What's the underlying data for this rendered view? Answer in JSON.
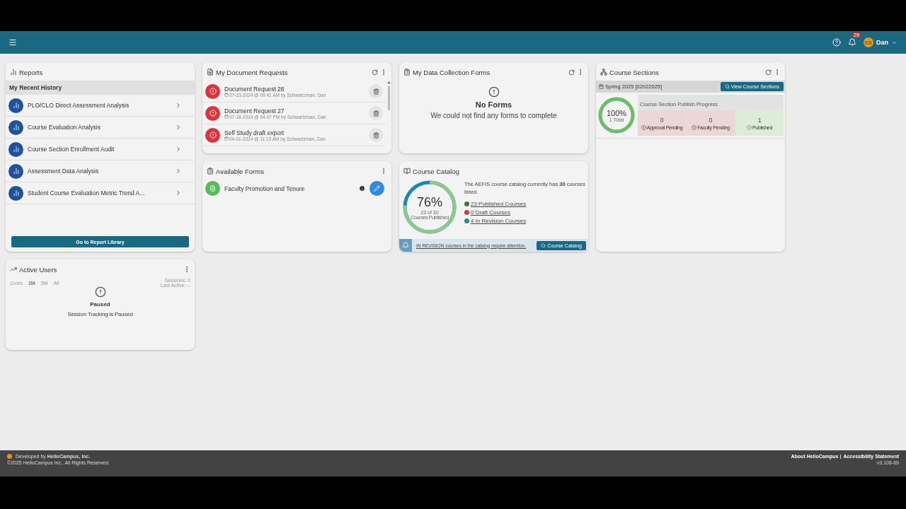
{
  "header": {
    "notification_count": "29",
    "avatar_initials": "DS",
    "user_name": "Dan"
  },
  "reports": {
    "title": "Reports",
    "section": "My Recent History",
    "items": [
      {
        "label": "PLO/CLO Direct Assessment Analysis"
      },
      {
        "label": "Course Evaluation Analysis"
      },
      {
        "label": "Course Section Enrollment Audit"
      },
      {
        "label": "Assessment Data Analysis"
      },
      {
        "label": "Student Course Evaluation Metric Trend A..."
      }
    ],
    "button": "Go to Report Library"
  },
  "document_requests": {
    "title": "My Document Requests",
    "items": [
      {
        "name": "Document Request 28",
        "meta": "07-23-2024 @ 09:41 AM by Schwartzman, Dan"
      },
      {
        "name": "Document Request 27",
        "meta": "07-18-2024 @ 04:07 PM by Schwartzman, Dan"
      },
      {
        "name": "Self Study draft export",
        "meta": "04-01-2024 @ 11:19 AM by Schwartzman, Dan"
      }
    ]
  },
  "data_collection": {
    "title": "My Data Collection Forms",
    "empty_title": "No Forms",
    "empty_text": "We could not find any forms to complete"
  },
  "course_sections": {
    "title": "Course Sections",
    "term": "Spring 2025 [02022025]",
    "button": "View Course Sections",
    "percent": "100%",
    "level": 1,
    "total": "1 Total",
    "progress_title": "Course Section Publish Progress",
    "stages": [
      {
        "count": "0",
        "label": "Approval Pending",
        "kind": "pending"
      },
      {
        "count": "0",
        "label": "Faculty Pending",
        "kind": "pending"
      },
      {
        "count": "1",
        "label": "Published",
        "kind": "done"
      }
    ]
  },
  "available_forms": {
    "title": "Available Forms",
    "items": [
      {
        "label": "Faculty Promotion and Tenure"
      }
    ]
  },
  "course_catalog": {
    "title": "Course Catalog",
    "percent": "76%",
    "level": 0.76,
    "sub": "23 of 30",
    "sub2": "Courses Published",
    "summary": "The AEFIS course catalog currently has **30** courses listed.",
    "links": [
      {
        "label": "23 Published Courses",
        "color": "#3f7a3c"
      },
      {
        "label": "0 Draft Courses",
        "color": "#c43d4e"
      },
      {
        "label": "4 In Revision Courses",
        "color": "#23908f"
      }
    ],
    "alert": "IN REVISION courses in the catalog require attention.",
    "button": "Course Catalog"
  },
  "active_users": {
    "title": "Active Users",
    "zoom_label": "Zoom",
    "zoom_options": [
      {
        "label": "1M",
        "selected": true
      },
      {
        "label": "5M",
        "selected": false
      },
      {
        "label": "All",
        "selected": false
      }
    ],
    "sessions": "Sessions: 0",
    "last_active": "Last Active: --",
    "status_title": "Paused",
    "status_text": "Session Tracking is Paused"
  },
  "footer": {
    "developed_by": "Developed by **HelioCampus, Inc.**",
    "copyright": "©2025 HelioCampus Inc., All Rights Reserved.",
    "links": [
      "About HelioCampus",
      "Accessibility Statement"
    ],
    "version": "v3.108-69"
  }
}
